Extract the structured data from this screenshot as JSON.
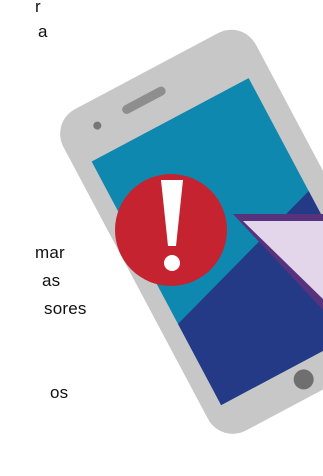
{
  "text_fragments": [
    "r",
    "a",
    "mar",
    "as",
    "sores",
    "os"
  ],
  "illustration": {
    "phone_frame_color": "#c7c7c7",
    "screen_top_color": "#0f88b0",
    "screen_bottom_color": "#243a86",
    "alert_circle_color": "#c4232f",
    "alert_glyph_color": "#ffffff",
    "bubble_fill_color": "#e4d6ea",
    "bubble_border_color": "#57327d",
    "speaker_color": "#8e8e8e",
    "button_color": "#6f6f6f"
  }
}
